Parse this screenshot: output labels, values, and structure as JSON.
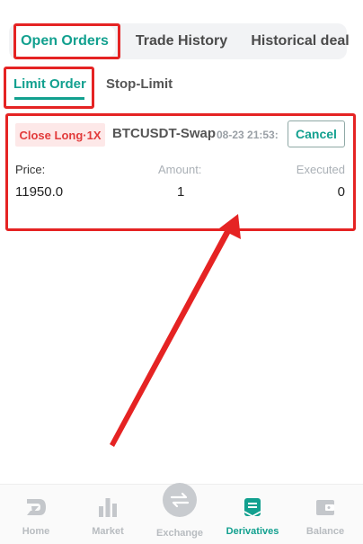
{
  "tabs": {
    "open_orders": "Open Orders",
    "trade_history": "Trade History",
    "historical_deal": "Historical deal"
  },
  "subtabs": {
    "limit_order": "Limit Order",
    "stop_limit": "Stop-Limit"
  },
  "order": {
    "side": "Close Long·1X",
    "pair": "BTCUSDT-Swap",
    "time": "08-23 21:53:",
    "cancel_label": "Cancel",
    "price_label": "Price:",
    "amount_label": "Amount:",
    "executed_label": "Executed",
    "price": "11950.0",
    "amount": "1",
    "executed": "0"
  },
  "nav": {
    "home": "Home",
    "market": "Market",
    "exchange": "Exchange",
    "derivatives": "Derivatives",
    "balance": "Balance"
  },
  "colors": {
    "accent": "#12a08f",
    "annotation": "#e52323",
    "sell": "#e23b3b",
    "inactive": "#b8bcc0"
  },
  "icons": {
    "home": "home-logo-icon",
    "market": "bar-chart-icon",
    "exchange": "swap-arrows-icon",
    "derivatives": "document-icon",
    "balance": "wallet-icon"
  }
}
